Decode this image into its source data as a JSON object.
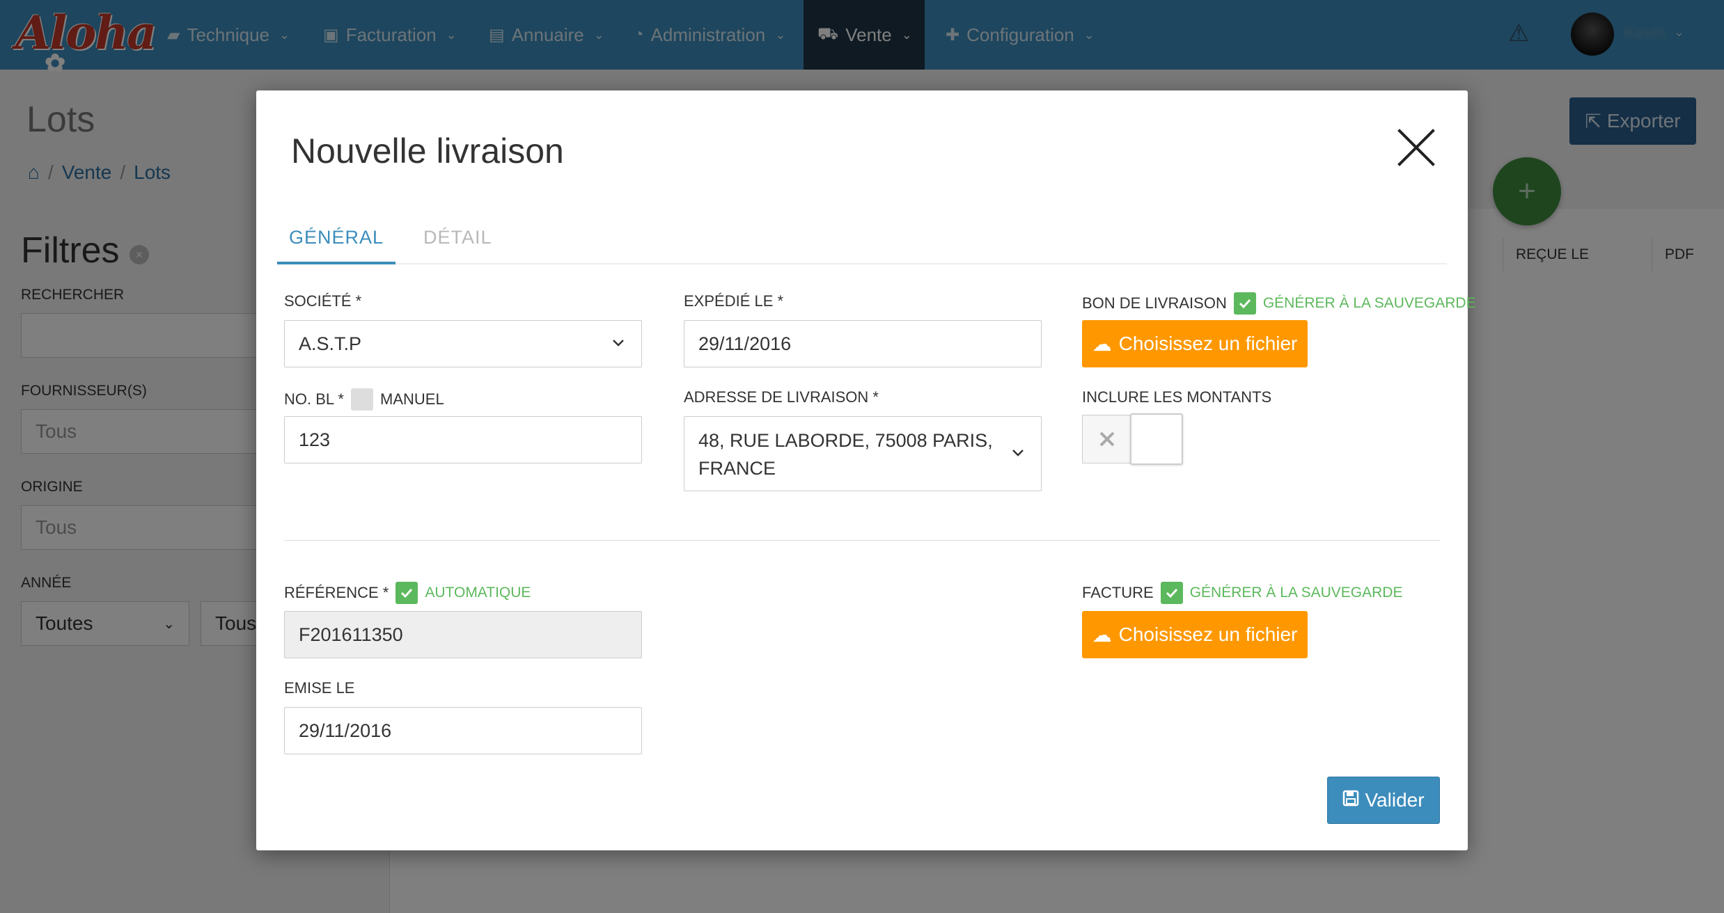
{
  "navbar": {
    "logo": "Aloha",
    "items": [
      {
        "label": "Technique",
        "icon": "briefcase-icon"
      },
      {
        "label": "Facturation",
        "icon": "money-icon"
      },
      {
        "label": "Annuaire",
        "icon": "book-icon"
      },
      {
        "label": "Administration",
        "icon": "dashboard-icon"
      },
      {
        "label": "Vente",
        "icon": "truck-icon",
        "active": true
      },
      {
        "label": "Configuration",
        "icon": "puzzle-icon"
      }
    ],
    "user_name": "Kevin"
  },
  "page": {
    "title": "Lots",
    "breadcrumb": [
      "Vente",
      "Lots"
    ],
    "export_label": "Exporter",
    "fab_label": "+"
  },
  "filters": {
    "title": "Filtres",
    "search_label": "RECHERCHER",
    "search_value": "",
    "supplier_label": "FOURNISSEUR(S)",
    "supplier_value": "Tous",
    "origin_label": "ORIGINE",
    "origin_value": "Tous",
    "year_label": "ANNÉE",
    "year_value": "Toutes",
    "year_value_2": "Tous"
  },
  "table": {
    "headers": [
      "REÇUE LE",
      "PDF"
    ]
  },
  "modal": {
    "title": "Nouvelle livraison",
    "tabs": [
      {
        "label": "GÉNÉRAL",
        "active": true
      },
      {
        "label": "DÉTAIL",
        "active": false
      }
    ],
    "societe": {
      "label": "SOCIÉTÉ *",
      "value": "A.S.T.P"
    },
    "expedie": {
      "label": "EXPÉDIÉ LE *",
      "value": "29/11/2016"
    },
    "bon_livraison": {
      "label": "BON DE LIVRAISON",
      "generate_label": "GÉNÉRER À LA SAUVEGARDE",
      "file_button": "Choisissez un fichier"
    },
    "no_bl": {
      "label": "NO. BL *",
      "manual_label": "MANUEL",
      "value": "123"
    },
    "adresse": {
      "label": "ADRESSE DE LIVRAISON *",
      "value_line1": "48, RUE LABORDE, 75008 PARIS,",
      "value_line2": "FRANCE"
    },
    "montants": {
      "label": "INCLURE LES MONTANTS"
    },
    "reference": {
      "label": "RÉFÉRENCE *",
      "auto_label": "AUTOMATIQUE",
      "value": "F201611350"
    },
    "facture": {
      "label": "FACTURE",
      "generate_label": "GÉNÉRER À LA SAUVEGARDE",
      "file_button": "Choisissez un fichier"
    },
    "emise": {
      "label": "EMISE LE",
      "value": "29/11/2016"
    },
    "submit_label": "Valider"
  },
  "colors": {
    "navbar": "#3c8dbc",
    "nav_active": "#1e3446",
    "accent": "#3c8dbc",
    "orange": "#ff9800",
    "green": "#5cb85c"
  }
}
